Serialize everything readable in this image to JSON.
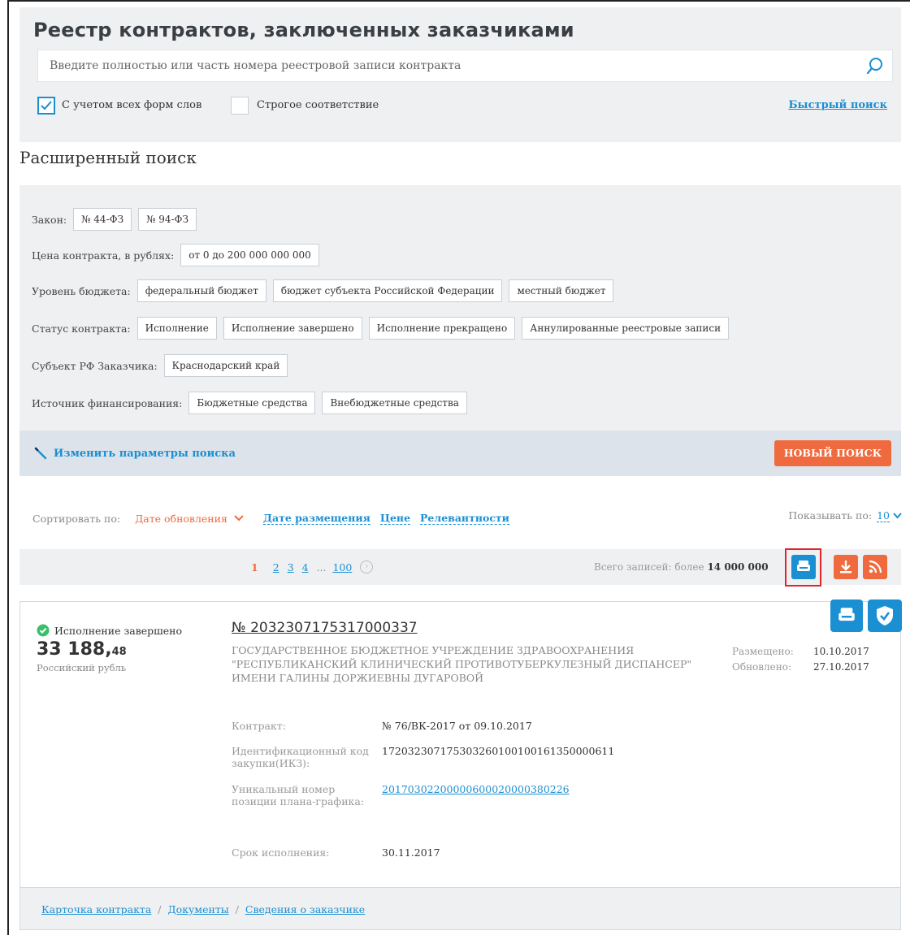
{
  "header": {
    "title": "Реестр контрактов, заключенных заказчиками",
    "search_placeholder": "Введите полностью или часть номера реестровой записи контракта",
    "opt_all_forms": "С учетом всех форм слов",
    "opt_strict": "Строгое соответствие",
    "quick_search": "Быстрый поиск"
  },
  "advanced": {
    "title": "Расширенный поиск",
    "filters": [
      {
        "label": "Закон:",
        "tags": [
          "№ 44-ФЗ",
          "№ 94-ФЗ"
        ]
      },
      {
        "label": "Цена контракта, в рублях:",
        "tags": [
          "от 0 до 200 000 000 000"
        ]
      },
      {
        "label": "Уровень бюджета:",
        "tags": [
          "федеральный бюджет",
          "бюджет субъекта Российской Федерации",
          "местный бюджет"
        ]
      },
      {
        "label": "Статус контракта:",
        "tags": [
          "Исполнение",
          "Исполнение завершено",
          "Исполнение прекращено",
          "Аннулированные реестровые записи"
        ]
      },
      {
        "label": "Субъект РФ Заказчика:",
        "tags": [
          "Краснодарский край"
        ]
      },
      {
        "label": "Источник финансирования:",
        "tags": [
          "Бюджетные средства",
          "Внебюджетные средства"
        ]
      }
    ],
    "edit_link": "Изменить параметры поиска",
    "new_search": "НОВЫЙ ПОИСК"
  },
  "sort": {
    "label": "Сортировать по:",
    "active": "Дате обновления",
    "options": [
      "Дате размещения",
      "Цене",
      "Релевантности"
    ],
    "show_label": "Показывать по:",
    "show_value": "10"
  },
  "pager": {
    "current": "1",
    "pages": [
      "2",
      "3",
      "4"
    ],
    "dots": "...",
    "last": "100",
    "total_label": "Всего записей: более",
    "total_value": "14 000 000"
  },
  "contract": {
    "status": "Исполнение завершено",
    "price_main": "33 188,",
    "price_cents": "48",
    "currency": "Российский рубль",
    "number": "№ 2032307175317000337",
    "customer": "ГОСУДАРСТВЕННОЕ БЮДЖЕТНОЕ УЧРЕЖДЕНИЕ ЗДРАВООХРАНЕНИЯ \"РЕСПУБЛИКАНСКИЙ КЛИНИЧЕСКИЙ ПРОТИВОТУБЕРКУЛЕЗНЫЙ ДИСПАНСЕР\" ИМЕНИ ГАЛИНЫ ДОРЖИЕВНЫ ДУГАРОВОЙ",
    "placed_label": "Размещено:",
    "placed_value": "10.10.2017",
    "updated_label": "Обновлено:",
    "updated_value": "27.10.2017",
    "details": [
      {
        "label": "Контракт:",
        "value": "№ 76/ВК-2017 от 09.10.2017"
      },
      {
        "label": "Идентификационный код закупки(ИКЗ):",
        "value": "172032307175303260100100161350000611"
      },
      {
        "label": "Уникальный номер позиции плана-графика:",
        "value": "201703022000006000200003802​26"
      },
      {
        "label": "Срок исполнения:",
        "value": "30.11.2017"
      }
    ],
    "footer_links": [
      "Карточка контракта",
      "Документы",
      "Сведения о заказчике"
    ]
  },
  "colors": {
    "accent_blue": "#1a8fd2",
    "accent_orange": "#ef6a3e",
    "status_green": "#3bbf6b",
    "highlight_red": "#e0242c"
  },
  "icons": [
    "search-icon",
    "checkbox-check-icon",
    "pencil-icon",
    "chevron-down-icon",
    "print-icon",
    "download-icon",
    "rss-icon",
    "shield-check-icon",
    "check-circle-icon"
  ]
}
